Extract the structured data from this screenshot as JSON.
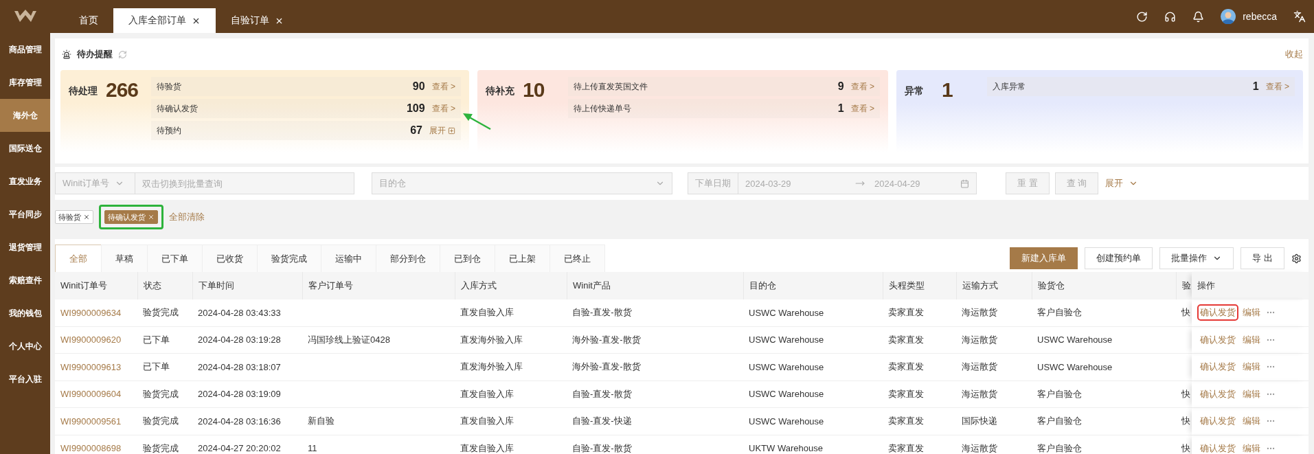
{
  "sidebar": {
    "items": [
      {
        "label": "商品管理",
        "selected": false
      },
      {
        "label": "库存管理",
        "selected": false
      },
      {
        "label": "海外仓",
        "selected": true
      },
      {
        "label": "国际送仓",
        "selected": false
      },
      {
        "label": "直发业务",
        "selected": false
      },
      {
        "label": "平台同步",
        "selected": false
      },
      {
        "label": "退货管理",
        "selected": false
      },
      {
        "label": "索赔查件",
        "selected": false
      },
      {
        "label": "我的钱包",
        "selected": false
      },
      {
        "label": "个人中心",
        "selected": false
      },
      {
        "label": "平台入驻",
        "selected": false
      }
    ]
  },
  "tabs": [
    {
      "label": "首页",
      "selected": false,
      "closable": false
    },
    {
      "label": "入库全部订单",
      "selected": true,
      "closable": true
    },
    {
      "label": "自验订单",
      "selected": false,
      "closable": true
    }
  ],
  "user": {
    "name": "rebecca"
  },
  "todo": {
    "title": "待办提醒",
    "collapse": "收起",
    "cards": [
      {
        "label": "待处理",
        "total": "266",
        "color": "#fdefd6",
        "items": [
          {
            "label": "待验货",
            "count": "90",
            "action": "查看 >",
            "kind": "view"
          },
          {
            "label": "待确认发货",
            "count": "109",
            "action": "查看 >",
            "kind": "view"
          },
          {
            "label": "待预约",
            "count": "67",
            "action": "展开",
            "kind": "expand"
          }
        ]
      },
      {
        "label": "待补充",
        "total": "10",
        "color": "#fde6df",
        "items": [
          {
            "label": "待上传直发英国文件",
            "count": "9",
            "action": "查看 >",
            "kind": "view"
          },
          {
            "label": "待上传快递单号",
            "count": "1",
            "action": "查看 >",
            "kind": "view"
          }
        ]
      },
      {
        "label": "异常",
        "total": "1",
        "color": "#e5e9fc",
        "items": [
          {
            "label": "入库异常",
            "count": "1",
            "action": "查看 >",
            "kind": "view"
          }
        ]
      }
    ]
  },
  "filters": {
    "order_type": "Winit订单号",
    "order_placeholder": "双击切换到批量查询",
    "warehouse_placeholder": "目的仓",
    "date_label": "下单日期",
    "date_from": "2024-03-29",
    "date_to": "2024-04-29",
    "reset": "重 置",
    "search": "查 询",
    "expand": "展开"
  },
  "active_filters": {
    "tags": [
      {
        "label": "待验货",
        "selected": false,
        "highlighted": false
      },
      {
        "label": "待确认发货",
        "selected": true,
        "highlighted": true
      }
    ],
    "clear": "全部清除"
  },
  "status_tabs": [
    {
      "label": "全部",
      "selected": true
    },
    {
      "label": "草稿",
      "selected": false
    },
    {
      "label": "已下单",
      "selected": false
    },
    {
      "label": "已收货",
      "selected": false
    },
    {
      "label": "验货完成",
      "selected": false
    },
    {
      "label": "运输中",
      "selected": false
    },
    {
      "label": "部分到仓",
      "selected": false
    },
    {
      "label": "已到仓",
      "selected": false
    },
    {
      "label": "已上架",
      "selected": false
    },
    {
      "label": "已终止",
      "selected": false
    }
  ],
  "actions": [
    {
      "label": "新建入库单",
      "kind": "primary"
    },
    {
      "label": "创建预约单",
      "kind": "default"
    },
    {
      "label": "批量操作",
      "kind": "dropdown"
    },
    {
      "label": "导 出",
      "kind": "default"
    }
  ],
  "table": {
    "columns": [
      "Winit订单号",
      "状态",
      "下单时间",
      "客户订单号",
      "入库方式",
      "Winit产品",
      "目的仓",
      "头程类型",
      "运输方式",
      "验货仓",
      "验",
      "操作"
    ],
    "rows": [
      {
        "order_no": "WI9900009634",
        "status": "验货完成",
        "time": "2024-04-28 03:43:33",
        "inbound_method": "直发自验入库",
        "product": "自验-直发-散货",
        "destination": "USWC Warehouse",
        "first_leg": "卖家直发",
        "transport": "海运散货",
        "inspection_warehouse": "客户自验仓",
        "column_11": "快",
        "actions": [
          {
            "label": "确认发货",
            "highlighted": true
          },
          {
            "label": "编辑",
            "highlighted": false
          }
        ]
      },
      {
        "order_no": "WI9900009620",
        "status": "已下单",
        "time": "2024-04-28 03:19:28",
        "customer_order": "冯国珍线上验证0428",
        "inbound_method": "直发海外验入库",
        "product": "海外验-直发-散货",
        "destination": "USWC Warehouse",
        "first_leg": "卖家直发",
        "transport": "海运散货",
        "inspection_warehouse": "USWC Warehouse",
        "actions": [
          {
            "label": "确认发货",
            "highlighted": false
          },
          {
            "label": "编辑",
            "highlighted": false
          }
        ]
      },
      {
        "order_no": "WI9900009613",
        "status": "已下单",
        "time": "2024-04-28 03:18:07",
        "inbound_method": "直发海外验入库",
        "product": "海外验-直发-散货",
        "destination": "USWC Warehouse",
        "first_leg": "卖家直发",
        "transport": "海运散货",
        "inspection_warehouse": "USWC Warehouse",
        "actions": [
          {
            "label": "确认发货",
            "highlighted": false
          },
          {
            "label": "编辑",
            "highlighted": false
          }
        ]
      },
      {
        "order_no": "WI9900009604",
        "status": "验货完成",
        "time": "2024-04-28 03:19:09",
        "inbound_method": "直发自验入库",
        "product": "自验-直发-散货",
        "destination": "USWC Warehouse",
        "first_leg": "卖家直发",
        "transport": "海运散货",
        "inspection_warehouse": "客户自验仓",
        "column_11": "快",
        "actions": [
          {
            "label": "确认发货",
            "highlighted": false
          },
          {
            "label": "编辑",
            "highlighted": false
          }
        ]
      },
      {
        "order_no": "WI9900009561",
        "status": "验货完成",
        "time": "2024-04-28 03:16:36",
        "customer_order": "新自验",
        "inbound_method": "直发自验入库",
        "product": "自验-直发-快递",
        "destination": "USWC Warehouse",
        "first_leg": "卖家直发",
        "transport": "国际快递",
        "inspection_warehouse": "客户自验仓",
        "column_11": "快",
        "actions": [
          {
            "label": "确认发货",
            "highlighted": false
          },
          {
            "label": "编辑",
            "highlighted": false
          }
        ]
      },
      {
        "order_no": "WI9900008698",
        "status": "验货完成",
        "time": "2024-04-27 20:20:02",
        "customer_order": "11",
        "inbound_method": "直发自验入库",
        "product": "自验-直发-散货",
        "destination": "UKTW Warehouse",
        "first_leg": "卖家直发",
        "transport": "海运散货",
        "inspection_warehouse": "客户自验仓",
        "column_11": "快",
        "actions": [
          {
            "label": "确认发货",
            "highlighted": false
          },
          {
            "label": "编辑",
            "highlighted": false
          }
        ]
      }
    ]
  }
}
